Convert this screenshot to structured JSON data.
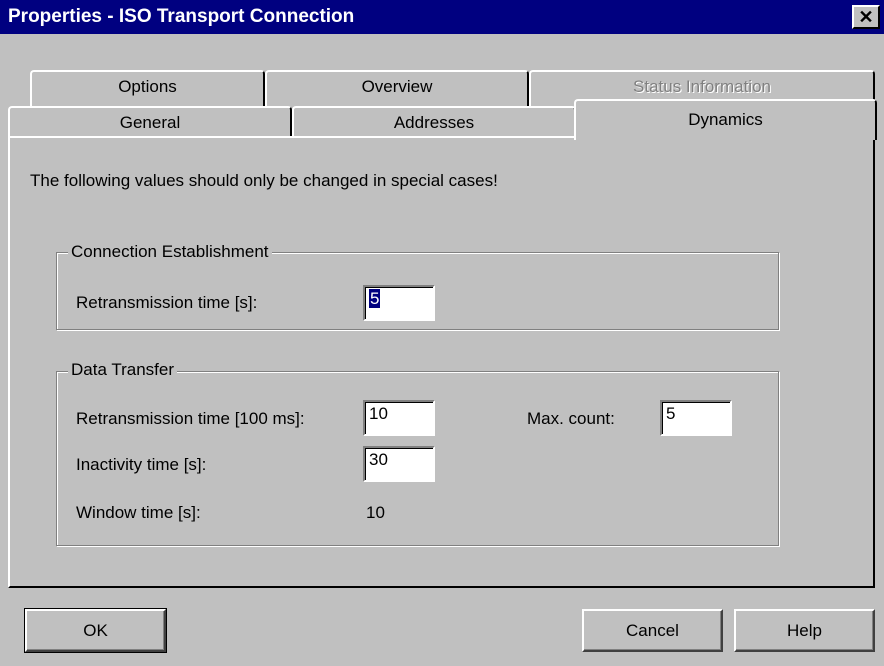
{
  "window": {
    "title": "Properties - ISO Transport Connection",
    "close_glyph": "✕"
  },
  "tabs": {
    "row_back": [
      {
        "label": "Options",
        "disabled": false
      },
      {
        "label": "Overview",
        "disabled": false
      },
      {
        "label": "Status Information",
        "disabled": true
      }
    ],
    "row_front": [
      {
        "label": "General",
        "active": false
      },
      {
        "label": "Addresses",
        "active": false
      },
      {
        "label": "Dynamics",
        "active": true
      }
    ]
  },
  "dynamics": {
    "note": "The following values should only be changed in special cases!",
    "connection_establishment": {
      "legend": "Connection Establishment",
      "retransmission_label": "Retransmission time [s]:",
      "retransmission_value": "5"
    },
    "data_transfer": {
      "legend": "Data Transfer",
      "retransmission_label": "Retransmission time [100 ms]:",
      "retransmission_value": "10",
      "max_count_label": "Max. count:",
      "max_count_value": "5",
      "inactivity_label": "Inactivity time [s]:",
      "inactivity_value": "30",
      "window_time_label": "Window time [s]:",
      "window_time_value": "10"
    }
  },
  "buttons": {
    "ok": "OK",
    "cancel": "Cancel",
    "help": "Help"
  },
  "colors": {
    "title_bar": "#000080",
    "face": "#c0c0c0",
    "selection": "#000080"
  }
}
